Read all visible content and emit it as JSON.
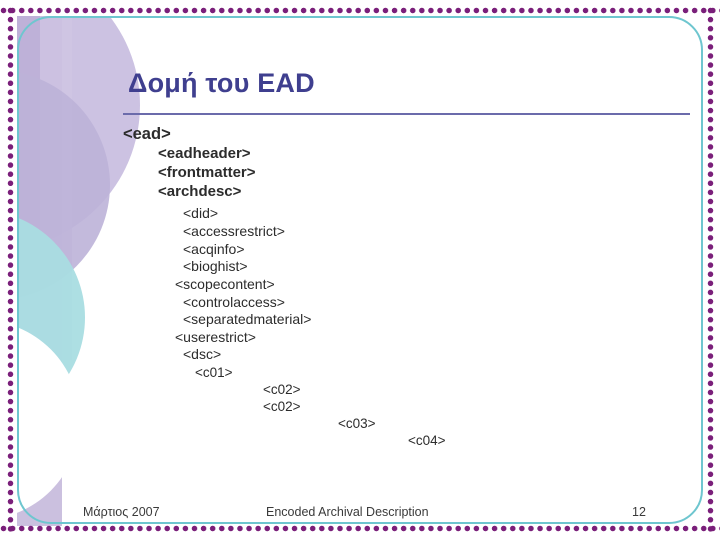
{
  "slide": {
    "title": "Δομή του EAD",
    "accent_color": "#3f3f8f",
    "border_dot_color": "#7a1f7a",
    "inner_frame_color": "#6ec6cf",
    "tree": [
      {
        "text": "<ead>",
        "level": "lvl0"
      },
      {
        "text": "<eadheader>",
        "level": "lvl1"
      },
      {
        "text": "<frontmatter>",
        "level": "lvl1"
      },
      {
        "text": "<archdesc>",
        "level": "lvl1"
      },
      {
        "text": "<did>",
        "level": "lvl2"
      },
      {
        "text": "<accessrestrict>",
        "level": "lvl2"
      },
      {
        "text": "<acqinfo>",
        "level": "lvl2"
      },
      {
        "text": "<bioghist>",
        "level": "lvl2"
      },
      {
        "text": "<scopecontent>",
        "level": "lvl3"
      },
      {
        "text": "<controlaccess>",
        "level": "lvl2"
      },
      {
        "text": "<separatedmaterial>",
        "level": "lvl2"
      },
      {
        "text": "<userestrict>",
        "level": "lvl3"
      },
      {
        "text": "<dsc>",
        "level": "lvl2"
      },
      {
        "text": "<c01>",
        "level": "lvl-c01"
      },
      {
        "text": "<c02>",
        "level": "lvl-c02"
      },
      {
        "text": "<c02>",
        "level": "lvl-c02"
      },
      {
        "text": "<c03>",
        "level": "lvl-c03"
      },
      {
        "text": "<c04>",
        "level": "lvl-c04"
      }
    ]
  },
  "footer": {
    "date": "Μάρτιος 2007",
    "center": "Encoded Archival Description",
    "page": "12"
  }
}
